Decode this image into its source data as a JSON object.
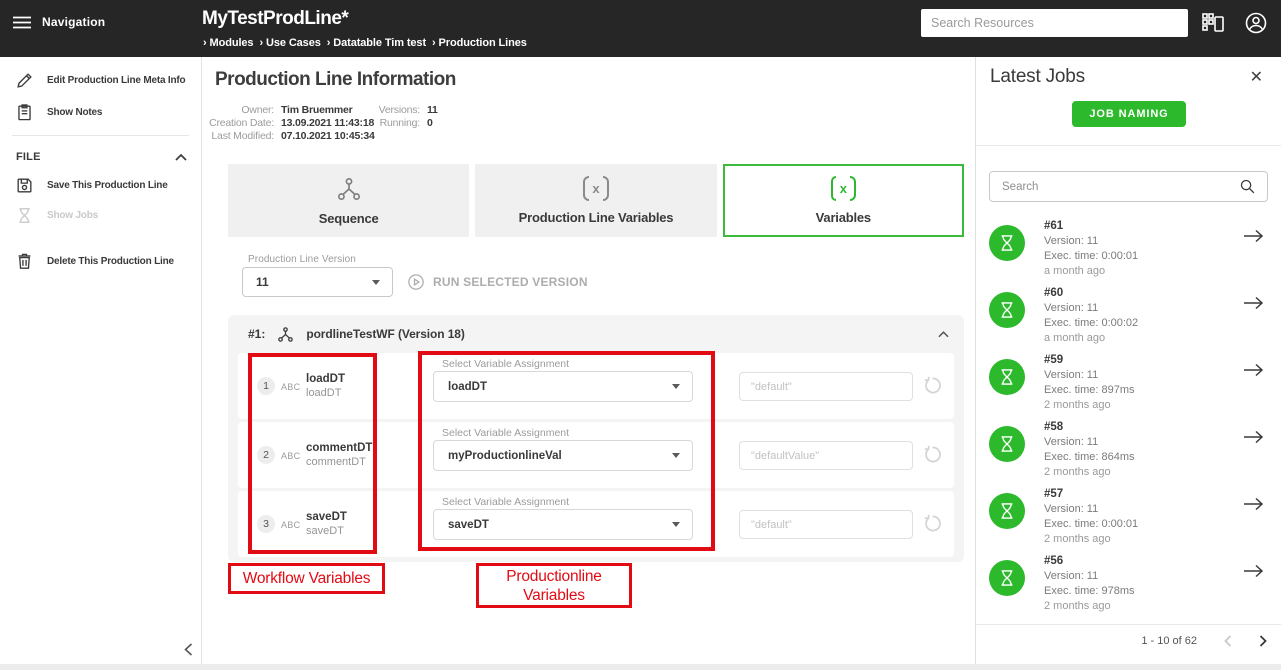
{
  "header": {
    "nav_label": "Navigation",
    "title": "MyTestProdLine*",
    "breadcrumbs": [
      "Modules",
      "Use Cases",
      "Datatable Tim test",
      "Production Lines"
    ],
    "search_placeholder": "Search Resources"
  },
  "sidebar": {
    "edit_meta": "Edit Production Line Meta Info",
    "show_notes": "Show Notes",
    "file_title": "FILE",
    "save": "Save This Production Line",
    "show_jobs": "Show Jobs",
    "delete": "Delete This Production Line"
  },
  "main": {
    "title": "Production Line Information",
    "meta": {
      "owner_label": "Owner:",
      "owner": "Tim Bruemmer",
      "creation_label": "Creation Date:",
      "creation": "13.09.2021 11:43:18",
      "modified_label": "Last Modified:",
      "modified": "07.10.2021 10:45:34",
      "versions_label": "Versions:",
      "versions": "11",
      "running_label": "Running:",
      "running": "0"
    },
    "tabs": [
      {
        "label": "Sequence"
      },
      {
        "label": "Production Line Variables"
      },
      {
        "label": "Variables"
      }
    ],
    "version_select_label": "Production Line Version",
    "version_value": "11",
    "run_label": "RUN SELECTED VERSION",
    "workflow_panel": {
      "index": "#1:",
      "title": "pordlineTestWF (Version 18)",
      "rows": [
        {
          "num": "1",
          "type": "ABC",
          "name": "loadDT",
          "subname": "loadDT",
          "select_label": "Select Variable Assignment",
          "select_value": "loadDT",
          "placeholder": "\"default\""
        },
        {
          "num": "2",
          "type": "ABC",
          "name": "commentDT",
          "subname": "commentDT",
          "select_label": "Select Variable Assignment",
          "select_value": "myProductionlineVal",
          "placeholder": "\"defaultValue\""
        },
        {
          "num": "3",
          "type": "ABC",
          "name": "saveDT",
          "subname": "saveDT",
          "select_label": "Select Variable Assignment",
          "select_value": "saveDT",
          "placeholder": "\"default\""
        }
      ]
    },
    "annotations": {
      "workflow_label": "Workflow Variables",
      "productionline_label": "Productionline Variables",
      "color": "#e30b13"
    }
  },
  "jobs_panel": {
    "title": "Latest Jobs",
    "button_label": "JOB NAMING",
    "search_placeholder": "Search",
    "jobs": [
      {
        "id": "#61",
        "version": "Version: 11",
        "exec": "Exec. time: 0:00:01",
        "ago": "a month ago"
      },
      {
        "id": "#60",
        "version": "Version: 11",
        "exec": "Exec. time: 0:00:02",
        "ago": "a month ago"
      },
      {
        "id": "#59",
        "version": "Version: 11",
        "exec": "Exec. time: 897ms",
        "ago": "2 months ago"
      },
      {
        "id": "#58",
        "version": "Version: 11",
        "exec": "Exec. time: 864ms",
        "ago": "2 months ago"
      },
      {
        "id": "#57",
        "version": "Version: 11",
        "exec": "Exec. time: 0:00:01",
        "ago": "2 months ago"
      },
      {
        "id": "#56",
        "version": "Version: 11",
        "exec": "Exec. time: 978ms",
        "ago": "2 months ago"
      }
    ],
    "pagination": "1 - 10 of 62"
  },
  "colors": {
    "green": "#2cb92c",
    "red": "#e30b13",
    "topbar": "#262626"
  }
}
